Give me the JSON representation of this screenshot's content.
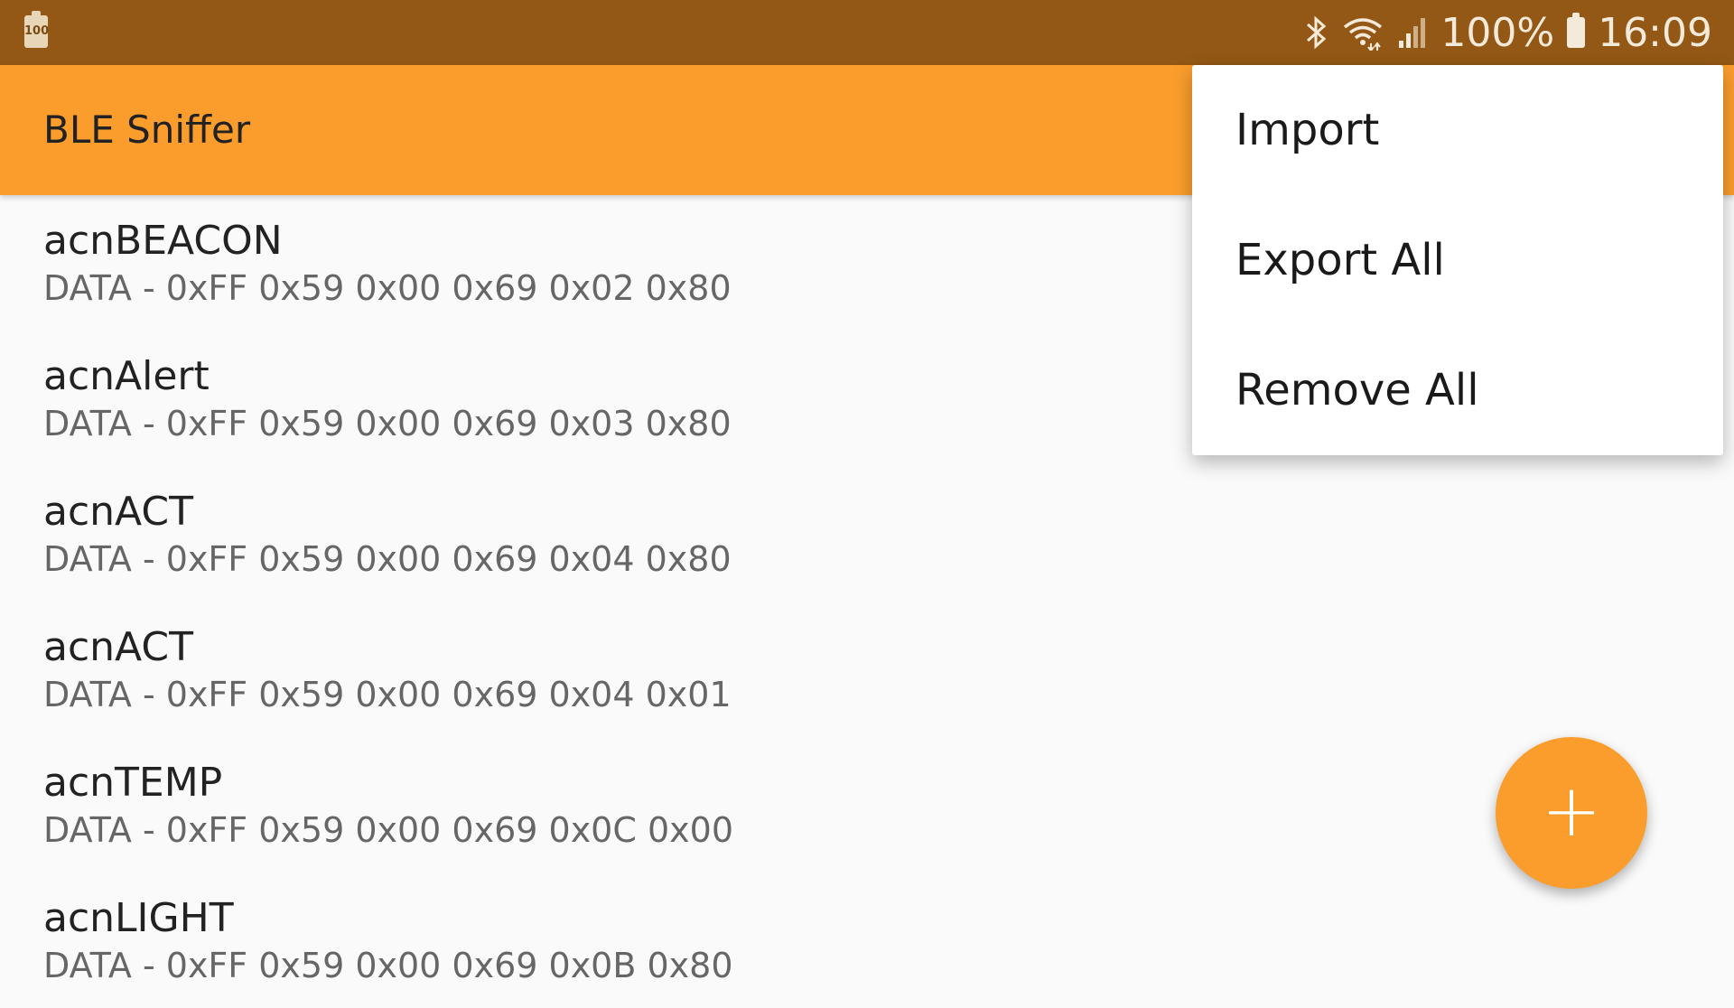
{
  "status_bar": {
    "battery_small_label": "100",
    "battery_percent": "100%",
    "time": "16:09"
  },
  "app_bar": {
    "title": "BLE Sniffer"
  },
  "list": {
    "items": [
      {
        "name": "acnBEACON",
        "data": "DATA - 0xFF 0x59 0x00 0x69 0x02 0x80"
      },
      {
        "name": "acnAlert",
        "data": "DATA - 0xFF 0x59 0x00 0x69 0x03 0x80"
      },
      {
        "name": "acnACT",
        "data": "DATA - 0xFF 0x59 0x00 0x69 0x04 0x80"
      },
      {
        "name": "acnACT",
        "data": "DATA - 0xFF 0x59 0x00 0x69 0x04 0x01"
      },
      {
        "name": "acnTEMP",
        "data": "DATA - 0xFF 0x59 0x00 0x69 0x0C 0x00"
      },
      {
        "name": "acnLIGHT",
        "data": "DATA - 0xFF 0x59 0x00 0x69 0x0B 0x80"
      }
    ]
  },
  "menu": {
    "items": [
      {
        "label": "Import"
      },
      {
        "label": "Export All"
      },
      {
        "label": "Remove All"
      }
    ]
  },
  "fab": {
    "icon": "plus-icon",
    "glyph": "+"
  },
  "colors": {
    "status_bar": "#935815",
    "app_bar": "#fa9d2c",
    "fab": "#fa9d2c",
    "background": "#fafafa"
  }
}
